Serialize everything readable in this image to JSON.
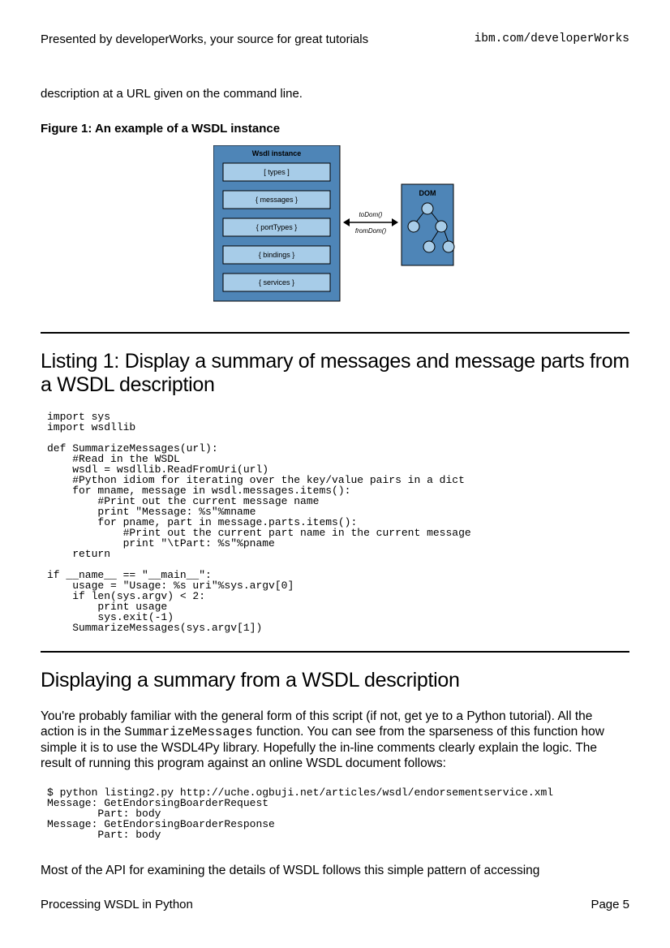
{
  "header": {
    "left": "Presented by developerWorks, your source for great tutorials",
    "right": "ibm.com/developerWorks"
  },
  "intro_line": "description at a URL given on the command line.",
  "figure_caption": "Figure 1: An example of a WSDL instance",
  "diagram": {
    "panel_title": "Wsdl instance",
    "items": [
      "[ types ]",
      "{ messages }",
      "{ portTypes }",
      "{ bindings }",
      "{ services }"
    ],
    "arrow_labels": {
      "top": "toDom()",
      "bottom": "fromDom()"
    },
    "dom_label": "DOM"
  },
  "listing1_title": "Listing 1: Display a summary of messages and message parts from a WSDL description",
  "listing1_code": "import sys\nimport wsdllib\n\ndef SummarizeMessages(url):\n    #Read in the WSDL\n    wsdl = wsdllib.ReadFromUri(url)\n    #Python idiom for iterating over the key/value pairs in a dict\n    for mname, message in wsdl.messages.items():\n        #Print out the current message name\n        print \"Message: %s\"%mname\n        for pname, part in message.parts.items():\n            #Print out the current part name in the current message\n            print \"\\tPart: %s\"%pname\n    return\n\nif __name__ == \"__main__\":\n    usage = \"Usage: %s uri\"%sys.argv[0]\n    if len(sys.argv) < 2:\n        print usage\n        sys.exit(-1)\n    SummarizeMessages(sys.argv[1])",
  "section2_title": "Displaying a summary from a WSDL description",
  "para1_a": "You're probably familiar with the general form of this script (if not, get ye to a Python tutorial). All the action is in the ",
  "para1_mono": "SummarizeMessages",
  "para1_b": " function. You can see from the sparseness of this function how simple it is to use the WSDL4Py library. Hopefully the in-line  comments clearly explain the logic. The result of running this program against an online WSDL document follows:",
  "output_block": "$ python listing2.py http://uche.ogbuji.net/articles/wsdl/endorsementservice.xml\nMessage: GetEndorsingBoarderRequest\n        Part: body\nMessage: GetEndorsingBoarderResponse\n        Part: body",
  "para2": "Most of the API for examining the details of WSDL follows this simple pattern of accessing",
  "footer": {
    "left": "Processing WSDL in Python",
    "right": "Page 5"
  }
}
